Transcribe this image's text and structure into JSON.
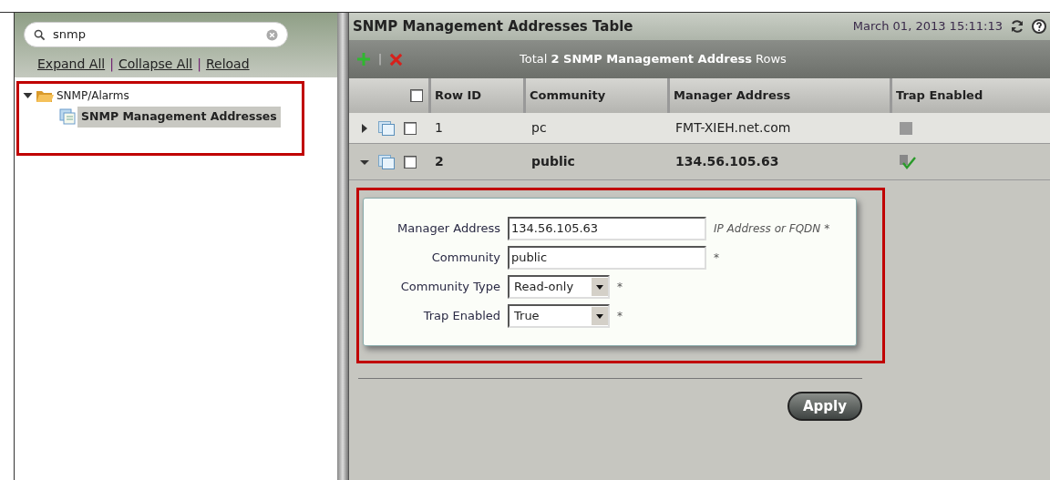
{
  "sidebar": {
    "search": {
      "value": "snmp"
    },
    "links": [
      "Expand All",
      "Collapse All",
      "Reload"
    ],
    "separator": "|",
    "tree": [
      {
        "label": "SNMP/Alarms",
        "expanded": true,
        "children": [
          {
            "label": "SNMP Management Addresses",
            "selected": true
          }
        ]
      }
    ]
  },
  "main": {
    "title": "SNMP Management Addresses Table",
    "datetime": "March 01, 2013 15:11:13",
    "toolbar": {
      "separator": "|",
      "summary": "Total **2 SNMP Management Address** Rows"
    },
    "table": {
      "select_all": false,
      "columns": [
        "Row ID",
        "Community",
        "Manager Address",
        "Trap Enabled"
      ],
      "rows": [
        {
          "row_id": "1",
          "community": "pc",
          "manager_address": "FMT-XIEH.net.com",
          "trap_enabled": false,
          "expanded": false,
          "checked": false
        },
        {
          "row_id": "2",
          "community": "public",
          "manager_address": "134.56.105.63",
          "trap_enabled": true,
          "expanded": true,
          "checked": false
        }
      ]
    },
    "detail": {
      "fields": [
        {
          "kind": "text",
          "label": "Manager Address",
          "value": "134.56.105.63",
          "hint": "IP Address or FQDN *"
        },
        {
          "kind": "text",
          "label": "Community",
          "value": "public",
          "hint": "*"
        },
        {
          "kind": "select",
          "label": "Community Type",
          "value": "Read-only",
          "hint": "*"
        },
        {
          "kind": "select",
          "label": "Trap Enabled",
          "value": "True",
          "hint": "*"
        }
      ]
    },
    "apply": "Apply"
  }
}
